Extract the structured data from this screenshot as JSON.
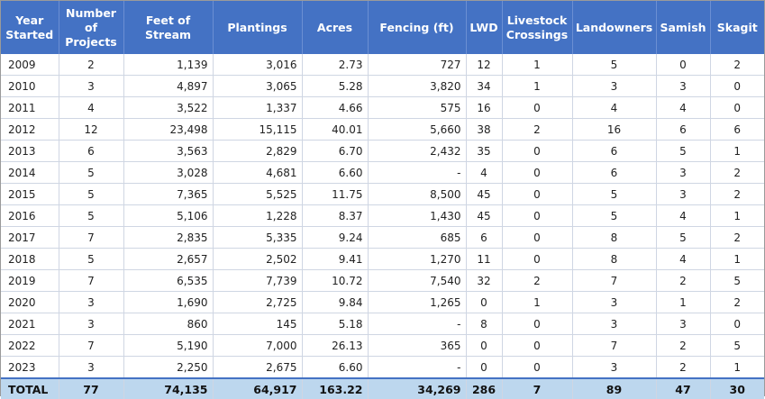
{
  "headers": [
    "Year Started",
    "Number of Projects",
    "Feet of Stream",
    "Plantings",
    "Acres",
    "Fencing (ft)",
    "LWD",
    "Livestock Crossings",
    "Landowners",
    "Samish",
    "Skagit"
  ],
  "rows": [
    [
      "2009",
      "2",
      "1,139",
      "3,016",
      "2.73",
      "727",
      "12",
      "1",
      "5",
      "0",
      "2"
    ],
    [
      "2010",
      "3",
      "4,897",
      "3,065",
      "5.28",
      "3,820",
      "34",
      "1",
      "3",
      "3",
      "0"
    ],
    [
      "2011",
      "4",
      "3,522",
      "1,337",
      "4.66",
      "575",
      "16",
      "0",
      "4",
      "4",
      "0"
    ],
    [
      "2012",
      "12",
      "23,498",
      "15,115",
      "40.01",
      "5,660",
      "38",
      "2",
      "16",
      "6",
      "6"
    ],
    [
      "2013",
      "6",
      "3,563",
      "2,829",
      "6.70",
      "2,432",
      "35",
      "0",
      "6",
      "5",
      "1"
    ],
    [
      "2014",
      "5",
      "3,028",
      "4,681",
      "6.60",
      "-",
      "4",
      "0",
      "6",
      "3",
      "2"
    ],
    [
      "2015",
      "5",
      "7,365",
      "5,525",
      "11.75",
      "8,500",
      "45",
      "0",
      "5",
      "3",
      "2"
    ],
    [
      "2016",
      "5",
      "5,106",
      "1,228",
      "8.37",
      "1,430",
      "45",
      "0",
      "5",
      "4",
      "1"
    ],
    [
      "2017",
      "7",
      "2,835",
      "5,335",
      "9.24",
      "685",
      "6",
      "0",
      "8",
      "5",
      "2"
    ],
    [
      "2018",
      "5",
      "2,657",
      "2,502",
      "9.41",
      "1,270",
      "11",
      "0",
      "8",
      "4",
      "1"
    ],
    [
      "2019",
      "7",
      "6,535",
      "7,739",
      "10.72",
      "7,540",
      "32",
      "2",
      "7",
      "2",
      "5"
    ],
    [
      "2020",
      "3",
      "1,690",
      "2,725",
      "9.84",
      "1,265",
      "0",
      "1",
      "3",
      "1",
      "2"
    ],
    [
      "2021",
      "3",
      "860",
      "145",
      "5.18",
      "-",
      "8",
      "0",
      "3",
      "3",
      "0"
    ],
    [
      "2022",
      "7",
      "5,190",
      "7,000",
      "26.13",
      "365",
      "0",
      "0",
      "7",
      "2",
      "5"
    ],
    [
      "2023",
      "3",
      "2,250",
      "2,675",
      "6.60",
      "-",
      "0",
      "0",
      "3",
      "2",
      "1"
    ]
  ],
  "total": [
    "TOTAL",
    "77",
    "74,135",
    "64,917",
    "163.22",
    "34,269",
    "286",
    "7",
    "89",
    "47",
    "30"
  ],
  "colors": {
    "header_bg": "#4472c4",
    "header_text": "#ffffff",
    "total_bg": "#bdd7ee",
    "grid": "#cfd6e3"
  }
}
